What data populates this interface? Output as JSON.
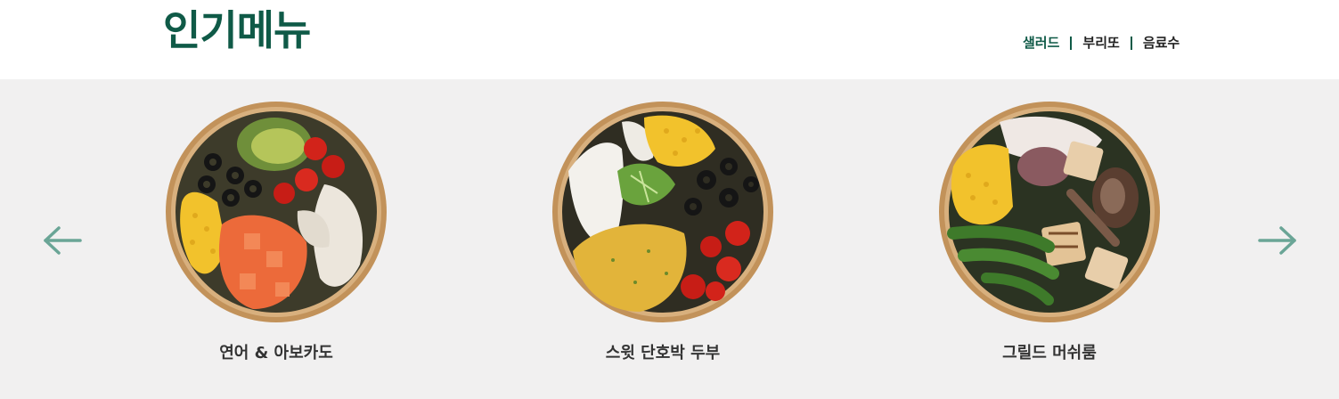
{
  "header": {
    "title": "인기메뉴",
    "categories": [
      {
        "label": "샐러드",
        "active": true
      },
      {
        "label": "부리또",
        "active": false
      },
      {
        "label": "음료수",
        "active": false
      }
    ]
  },
  "carousel": {
    "prev_icon": "arrow-left-icon",
    "next_icon": "arrow-right-icon",
    "items": [
      {
        "name": "연어 & 아보카도"
      },
      {
        "name": "스윗 단호박 두부"
      },
      {
        "name": "그릴드 머쉬룸"
      }
    ]
  },
  "colors": {
    "brand_green": "#0f5a47",
    "arrow": "#6aa596",
    "band_bg": "#f1f0f0",
    "bowl_rim": "#c2925a"
  }
}
